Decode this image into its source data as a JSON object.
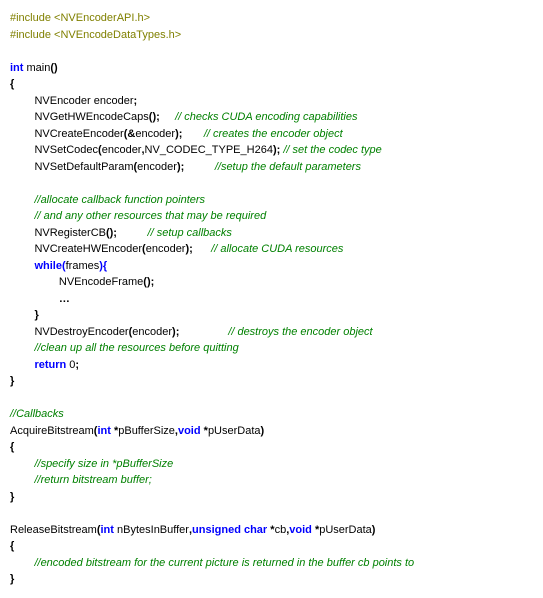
{
  "lines": [
    [
      {
        "cls": "pp",
        "t": "#include <NVEncoderAPI.h>"
      }
    ],
    [
      {
        "cls": "pp",
        "t": "#include <NVEncodeDataTypes.h>"
      }
    ],
    [],
    [
      {
        "cls": "kw",
        "t": "int"
      },
      {
        "cls": "plain",
        "t": " main"
      },
      {
        "cls": "fn",
        "t": "()"
      }
    ],
    [
      {
        "cls": "fn",
        "t": "{"
      }
    ],
    [
      {
        "cls": "plain",
        "t": "        NVEncoder encoder"
      },
      {
        "cls": "fn",
        "t": ";"
      }
    ],
    [
      {
        "cls": "plain",
        "t": "        NVGetHWEncodeCaps"
      },
      {
        "cls": "fn",
        "t": "();"
      },
      {
        "cls": "plain",
        "t": "     "
      },
      {
        "cls": "cm",
        "t": "// checks CUDA encoding capabilities"
      }
    ],
    [
      {
        "cls": "plain",
        "t": "        NVCreateEncoder"
      },
      {
        "cls": "fn",
        "t": "(&"
      },
      {
        "cls": "plain",
        "t": "encoder"
      },
      {
        "cls": "fn",
        "t": ");"
      },
      {
        "cls": "plain",
        "t": "       "
      },
      {
        "cls": "cm",
        "t": "// creates the encoder object"
      }
    ],
    [
      {
        "cls": "plain",
        "t": "        NVSetCodec"
      },
      {
        "cls": "fn",
        "t": "("
      },
      {
        "cls": "plain",
        "t": "encoder"
      },
      {
        "cls": "fn",
        "t": ","
      },
      {
        "cls": "plain",
        "t": "NV_CODEC_TYPE_H264"
      },
      {
        "cls": "fn",
        "t": ");"
      },
      {
        "cls": "plain",
        "t": " "
      },
      {
        "cls": "cm",
        "t": "// set the codec type"
      }
    ],
    [
      {
        "cls": "plain",
        "t": "        NVSetDefaultParam"
      },
      {
        "cls": "fn",
        "t": "("
      },
      {
        "cls": "plain",
        "t": "encoder"
      },
      {
        "cls": "fn",
        "t": ");"
      },
      {
        "cls": "plain",
        "t": "          "
      },
      {
        "cls": "cm",
        "t": "//setup the default parameters"
      }
    ],
    [],
    [
      {
        "cls": "plain",
        "t": "        "
      },
      {
        "cls": "cm",
        "t": "//allocate callback function pointers"
      }
    ],
    [
      {
        "cls": "plain",
        "t": "        "
      },
      {
        "cls": "cm",
        "t": "// and any other resources that may be required"
      }
    ],
    [
      {
        "cls": "plain",
        "t": "        NVRegisterCB"
      },
      {
        "cls": "fn",
        "t": "();"
      },
      {
        "cls": "plain",
        "t": "          "
      },
      {
        "cls": "cm",
        "t": "// setup callbacks"
      }
    ],
    [
      {
        "cls": "plain",
        "t": "        NVCreateHWEncoder"
      },
      {
        "cls": "fn",
        "t": "("
      },
      {
        "cls": "plain",
        "t": "encoder"
      },
      {
        "cls": "fn",
        "t": ");"
      },
      {
        "cls": "plain",
        "t": "      "
      },
      {
        "cls": "cm",
        "t": "// allocate CUDA resources"
      }
    ],
    [
      {
        "cls": "plain",
        "t": "        "
      },
      {
        "cls": "kw",
        "t": "while("
      },
      {
        "cls": "plain",
        "t": "frames"
      },
      {
        "cls": "kw",
        "t": "){"
      }
    ],
    [
      {
        "cls": "plain",
        "t": "                NVEncodeFrame"
      },
      {
        "cls": "fn",
        "t": "();"
      }
    ],
    [
      {
        "cls": "plain",
        "t": "                "
      },
      {
        "cls": "fn",
        "t": "…"
      }
    ],
    [
      {
        "cls": "plain",
        "t": "        "
      },
      {
        "cls": "fn",
        "t": "}"
      }
    ],
    [
      {
        "cls": "plain",
        "t": "        NVDestroyEncoder"
      },
      {
        "cls": "fn",
        "t": "("
      },
      {
        "cls": "plain",
        "t": "encoder"
      },
      {
        "cls": "fn",
        "t": ");"
      },
      {
        "cls": "plain",
        "t": "                "
      },
      {
        "cls": "cm",
        "t": "// destroys the encoder object"
      }
    ],
    [
      {
        "cls": "plain",
        "t": "        "
      },
      {
        "cls": "cm",
        "t": "//clean up all the resources before quitting"
      }
    ],
    [
      {
        "cls": "plain",
        "t": "        "
      },
      {
        "cls": "kw",
        "t": "return"
      },
      {
        "cls": "plain",
        "t": " 0"
      },
      {
        "cls": "fn",
        "t": ";"
      }
    ],
    [
      {
        "cls": "fn",
        "t": "}"
      }
    ],
    [],
    [
      {
        "cls": "cm",
        "t": "//Callbacks"
      }
    ],
    [
      {
        "cls": "plain",
        "t": "AcquireBitstream"
      },
      {
        "cls": "fn",
        "t": "("
      },
      {
        "cls": "kw",
        "t": "int"
      },
      {
        "cls": "plain",
        "t": " "
      },
      {
        "cls": "fn",
        "t": "*"
      },
      {
        "cls": "plain",
        "t": "pBufferSize"
      },
      {
        "cls": "fn",
        "t": ","
      },
      {
        "cls": "kw",
        "t": "void"
      },
      {
        "cls": "plain",
        "t": " "
      },
      {
        "cls": "fn",
        "t": "*"
      },
      {
        "cls": "plain",
        "t": "pUserData"
      },
      {
        "cls": "fn",
        "t": ")"
      }
    ],
    [
      {
        "cls": "fn",
        "t": "{"
      }
    ],
    [
      {
        "cls": "plain",
        "t": "        "
      },
      {
        "cls": "cm",
        "t": "//specify size in *pBufferSize"
      }
    ],
    [
      {
        "cls": "plain",
        "t": "        "
      },
      {
        "cls": "cm",
        "t": "//return bitstream buffer;"
      }
    ],
    [
      {
        "cls": "fn",
        "t": "}"
      }
    ],
    [],
    [
      {
        "cls": "plain",
        "t": "ReleaseBitstream"
      },
      {
        "cls": "fn",
        "t": "("
      },
      {
        "cls": "kw",
        "t": "int"
      },
      {
        "cls": "plain",
        "t": " nBytesInBuffer"
      },
      {
        "cls": "fn",
        "t": ","
      },
      {
        "cls": "kw",
        "t": "unsigned char"
      },
      {
        "cls": "plain",
        "t": " "
      },
      {
        "cls": "fn",
        "t": "*"
      },
      {
        "cls": "plain",
        "t": "cb"
      },
      {
        "cls": "fn",
        "t": ","
      },
      {
        "cls": "kw",
        "t": "void"
      },
      {
        "cls": "plain",
        "t": " "
      },
      {
        "cls": "fn",
        "t": "*"
      },
      {
        "cls": "plain",
        "t": "pUserData"
      },
      {
        "cls": "fn",
        "t": ")"
      }
    ],
    [
      {
        "cls": "fn",
        "t": "{"
      }
    ],
    [
      {
        "cls": "plain",
        "t": "        "
      },
      {
        "cls": "cm",
        "t": "//encoded bitstream for the current picture is returned in the buffer cb points to"
      }
    ],
    [
      {
        "cls": "fn",
        "t": "}"
      }
    ]
  ]
}
